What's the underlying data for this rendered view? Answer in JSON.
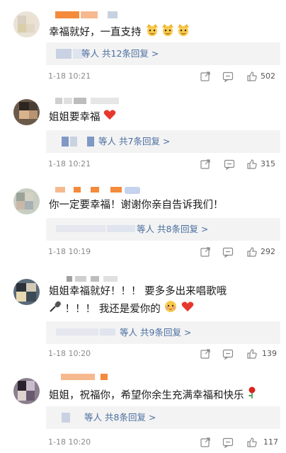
{
  "comments": [
    {
      "text": "幸福就好，一直支持",
      "reply_label": "等人",
      "reply_count": "共12条回复 >",
      "time": "1-18 10:21",
      "likes": "502",
      "emoji": [
        "crown-face",
        "crown-face",
        "crown-face"
      ]
    },
    {
      "text": "姐姐要幸福",
      "reply_label": "等人",
      "reply_count": "共7条回复 >",
      "time": "1-18 10:21",
      "likes": "315",
      "emoji": [
        "red-heart"
      ]
    },
    {
      "text": "你一定要幸福！谢谢你亲自告诉我们！",
      "reply_label": "等人",
      "reply_count": "共8条回复 >",
      "time": "1-18 10:19",
      "likes": "292",
      "emoji": []
    },
    {
      "text": "姐姐幸福就好！！！ 要多多出来唱歌哦",
      "text2": "！！！ 我还是爱你的",
      "reply_label": "等人",
      "reply_count": "共9条回复 >",
      "time": "1-18 10:20",
      "likes": "139",
      "emoji": [
        "microphone",
        "blushing-face",
        "red-heart"
      ]
    },
    {
      "text": "姐姐，祝福你，希望你余生充满幸福和快乐",
      "reply_label": "等人",
      "reply_count": "共8条回复 >",
      "time": "1-18 10:20",
      "likes": "117",
      "emoji": [
        "rose"
      ]
    }
  ],
  "icons": {
    "share": "share-icon",
    "comment": "comment-icon",
    "like": "thumbs-up-icon"
  },
  "colors": {
    "reply_link": "#4a6ea0",
    "reply_bg": "#f3f3f3",
    "username_orange": "#f48a3a",
    "meta_gray": "#8a8a8a"
  }
}
